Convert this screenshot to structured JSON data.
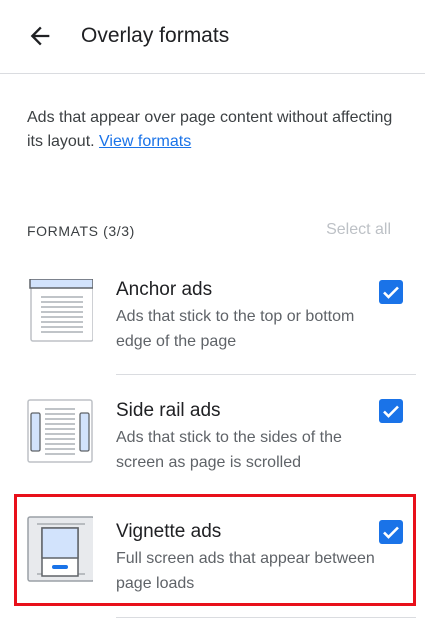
{
  "header": {
    "title": "Overlay formats",
    "back_icon": "arrow-back-icon"
  },
  "description": {
    "text": "Ads that appear over page content without affecting its layout. ",
    "link": "View formats"
  },
  "formats": {
    "label": "FORMATS (3/3)",
    "select_all": "Select all",
    "items": [
      {
        "title": "Anchor ads",
        "description": "Ads that stick to the top or bottom edge of the page",
        "checked": true,
        "icon": "anchor-ad-thumbnail"
      },
      {
        "title": "Side rail ads",
        "description": "Ads that stick to the sides of the screen as page is scrolled",
        "checked": true,
        "icon": "side-rail-ad-thumbnail"
      },
      {
        "title": "Vignette ads",
        "description": "Full screen ads that appear between page loads",
        "checked": true,
        "icon": "vignette-ad-thumbnail"
      }
    ]
  },
  "colors": {
    "accent": "#1a73e8",
    "highlight": "#e8101a",
    "divider": "#dadce0"
  }
}
